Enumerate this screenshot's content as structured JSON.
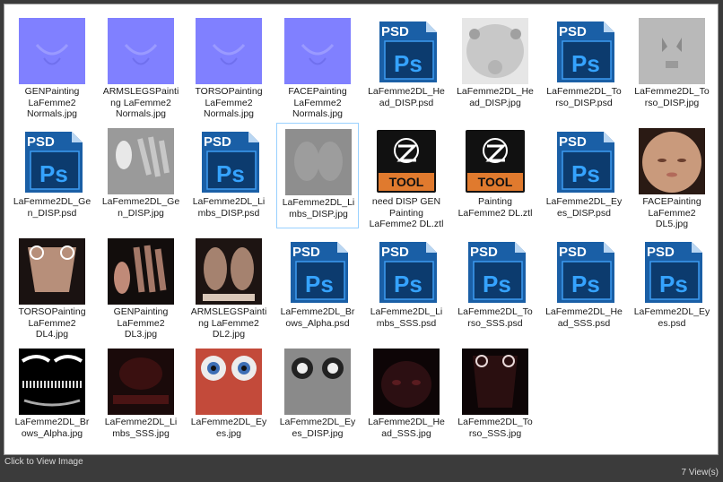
{
  "files": [
    {
      "name": "GENPainting LaFemme2 Normals.jpg",
      "thumb": "normal-map"
    },
    {
      "name": "ARMSLEGSPainting LaFemme2 Normals.jpg",
      "thumb": "normal-map"
    },
    {
      "name": "TORSOPainting LaFemme2 Normals.jpg",
      "thumb": "normal-map"
    },
    {
      "name": "FACEPainting LaFemme2 Normals.jpg",
      "thumb": "normal-map"
    },
    {
      "name": "LaFemme2DL_Head_DISP.psd",
      "thumb": "psd-icon"
    },
    {
      "name": "LaFemme2DL_Head_DISP.jpg",
      "thumb": "grey-head"
    },
    {
      "name": "LaFemme2DL_Torso_DISP.psd",
      "thumb": "psd-icon"
    },
    {
      "name": "LaFemme2DL_Torso_DISP.jpg",
      "thumb": "grey-torso"
    },
    {
      "name": "LaFemme2DL_Gen_DISP.psd",
      "thumb": "psd-icon"
    },
    {
      "name": "LaFemme2DL_Gen_DISP.jpg",
      "thumb": "grey-gen"
    },
    {
      "name": "LaFemme2DL_Limbs_DISP.psd",
      "thumb": "psd-icon"
    },
    {
      "name": "LaFemme2DL_Limbs_DISP.jpg",
      "thumb": "grey-limbs"
    },
    {
      "name": "need DISP GEN Painting LaFemme2 DL.ztl",
      "thumb": "tool-icon"
    },
    {
      "name": "Painting LaFemme2 DL.ztl",
      "thumb": "tool-icon"
    },
    {
      "name": "LaFemme2DL_Eyes_DISP.psd",
      "thumb": "psd-icon"
    },
    {
      "name": "FACEPainting LaFemme2 DL5.jpg",
      "thumb": "face-skin"
    },
    {
      "name": "TORSOPainting LaFemme2 DL4.jpg",
      "thumb": "torso-skin"
    },
    {
      "name": "GENPainting LaFemme2 DL3.jpg",
      "thumb": "gen-skin"
    },
    {
      "name": "ARMSLEGSPainting LaFemme2 DL2.jpg",
      "thumb": "limbs-skin"
    },
    {
      "name": "LaFemme2DL_Brows_Alpha.psd",
      "thumb": "psd-icon"
    },
    {
      "name": "LaFemme2DL_Limbs_SSS.psd",
      "thumb": "psd-icon"
    },
    {
      "name": "LaFemme2DL_Torso_SSS.psd",
      "thumb": "psd-icon"
    },
    {
      "name": "LaFemme2DL_Head_SSS.psd",
      "thumb": "psd-icon"
    },
    {
      "name": "LaFemme2DL_Eyes.psd",
      "thumb": "psd-icon"
    },
    {
      "name": "LaFemme2DL_Brows_Alpha.jpg",
      "thumb": "brows-alpha"
    },
    {
      "name": "LaFemme2DL_Limbs_SSS.jpg",
      "thumb": "sss-dark"
    },
    {
      "name": "LaFemme2DL_Eyes.jpg",
      "thumb": "eyes-red"
    },
    {
      "name": "LaFemme2DL_Eyes_DISP.jpg",
      "thumb": "eyes-grey"
    },
    {
      "name": "LaFemme2DL_Head_SSS.jpg",
      "thumb": "sss-head"
    },
    {
      "name": "LaFemme2DL_Torso_SSS.jpg",
      "thumb": "sss-torso"
    }
  ],
  "labels": [
    "GENPainting\nLaFemme2\nNormals.jpg",
    "ARMSLEGSPainti\nng LaFemme2\nNormals.jpg",
    "TORSOPainting\nLaFemme2\nNormals.jpg",
    "FACEPainting\nLaFemme2\nNormals.jpg",
    "LaFemme2DL_He\nad_DISP.psd",
    "LaFemme2DL_He\nad_DISP.jpg",
    "LaFemme2DL_To\nrso_DISP.psd",
    "LaFemme2DL_To\nrso_DISP.jpg",
    "LaFemme2DL_Ge\nn_DISP.psd",
    "LaFemme2DL_Ge\nn_DISP.jpg",
    "LaFemme2DL_Li\nmbs_DISP.psd",
    "LaFemme2DL_Li\nmbs_DISP.jpg",
    "need DISP GEN\nPainting\nLaFemme2 DL.ztl",
    "Painting\nLaFemme2 DL.ztl",
    "LaFemme2DL_Ey\nes_DISP.psd",
    "FACEPainting\nLaFemme2\nDL5.jpg",
    "TORSOPainting\nLaFemme2\nDL4.jpg",
    "GENPainting\nLaFemme2\nDL3.jpg",
    "ARMSLEGSPainti\nng LaFemme2\nDL2.jpg",
    "LaFemme2DL_Br\nows_Alpha.psd",
    "LaFemme2DL_Li\nmbs_SSS.psd",
    "LaFemme2DL_To\nrso_SSS.psd",
    "LaFemme2DL_He\nad_SSS.psd",
    "LaFemme2DL_Ey\nes.psd",
    "LaFemme2DL_Br\nows_Alpha.jpg",
    "LaFemme2DL_Li\nmbs_SSS.jpg",
    "LaFemme2DL_Ey\nes.jpg",
    "LaFemme2DL_Ey\nes_DISP.jpg",
    "LaFemme2DL_He\nad_SSS.jpg",
    "LaFemme2DL_To\nrso_SSS.jpg"
  ],
  "psd_icon_text": {
    "badge": "PSD",
    "logo": "Ps"
  },
  "tool_icon_text": "TOOL",
  "selected_index": 11,
  "footer": {
    "click_label": "Click to View Image",
    "views_label": "7 View(s)"
  },
  "colors": {
    "psd_blue": "#1e73be",
    "psd_dark": "#0b3d73",
    "selection_border": "#99d1ff",
    "normal_map": "#8080ff",
    "tool_orange": "#e07a2e"
  }
}
